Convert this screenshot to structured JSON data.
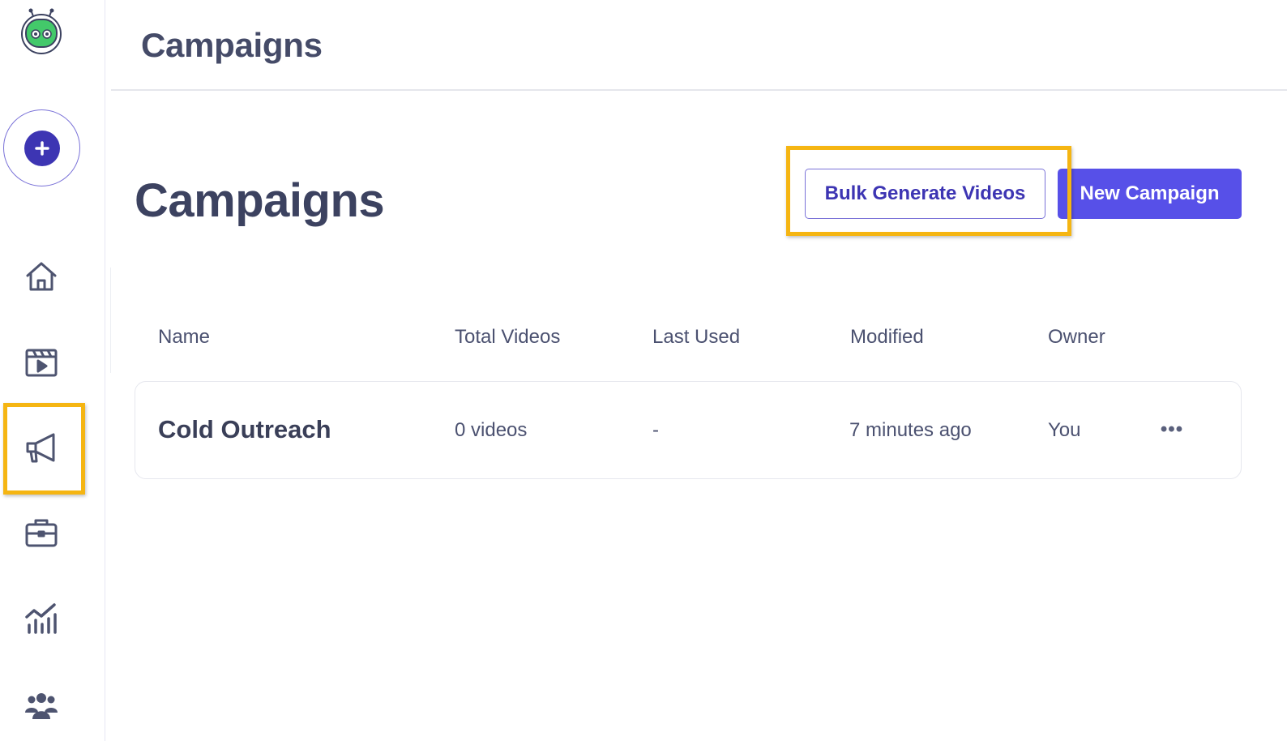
{
  "app": {
    "logo_icon": "robot-logo-icon"
  },
  "sidebar": {
    "create_icon": "plus-icon",
    "items": [
      {
        "icon": "home-icon"
      },
      {
        "icon": "video-clapper-icon"
      },
      {
        "icon": "megaphone-icon",
        "selected": true
      },
      {
        "icon": "briefcase-icon"
      },
      {
        "icon": "analytics-chart-icon"
      },
      {
        "icon": "team-icon"
      }
    ]
  },
  "header": {
    "title": "Campaigns"
  },
  "main": {
    "title": "Campaigns",
    "bulk_button_label": "Bulk Generate Videos",
    "new_button_label": "New Campaign",
    "table": {
      "columns": [
        "Name",
        "Total Videos",
        "Last Used",
        "Modified",
        "Owner"
      ],
      "rows": [
        {
          "name": "Cold Outreach",
          "total_videos": "0 videos",
          "last_used": "-",
          "modified": "7 minutes ago",
          "owner": "You",
          "more": "•••"
        }
      ]
    }
  },
  "colors": {
    "accent": "#5750e8",
    "accent_dark": "#3d35b3",
    "highlight": "#f5b512",
    "text": "#3f4561"
  }
}
